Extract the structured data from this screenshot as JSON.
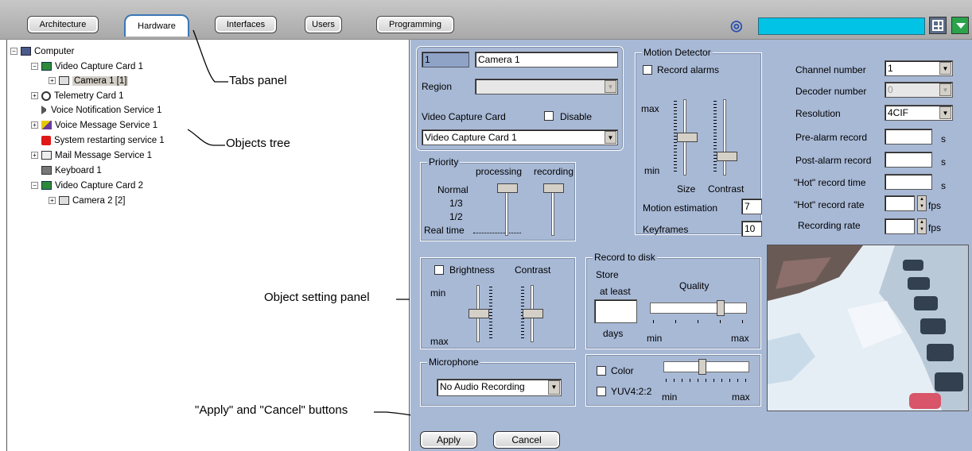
{
  "tabs": [
    "Architecture",
    "Hardware",
    "Interfaces",
    "Users",
    "Programming"
  ],
  "colors": {
    "accent": "#00c3e6",
    "panel": "#a8b9d6",
    "active_tab": "#3a77b5"
  },
  "tree": {
    "items": [
      {
        "label": "Computer",
        "icon": "computer-icon"
      },
      {
        "label": "Video Capture Card 1",
        "icon": "capture-card-icon"
      },
      {
        "label": "Camera 1 [1]",
        "icon": "camera-icon"
      },
      {
        "label": "Telemetry Card 1",
        "icon": "telemetry-icon"
      },
      {
        "label": "Voice Notification Service 1",
        "icon": "speaker-icon"
      },
      {
        "label": "Voice Message Service 1",
        "icon": "voice-message-icon"
      },
      {
        "label": "System restarting service 1",
        "icon": "restart-icon"
      },
      {
        "label": "Mail Message Service 1",
        "icon": "mail-icon"
      },
      {
        "label": "Keyboard 1",
        "icon": "keyboard-icon"
      },
      {
        "label": "Video Capture Card 2",
        "icon": "capture-card-icon"
      },
      {
        "label": "Camera 2 [2]",
        "icon": "camera-icon"
      }
    ]
  },
  "annotations": {
    "tabs_panel": "Tabs panel",
    "objects_tree": "Objects tree",
    "object_setting_panel": "Object setting panel",
    "apply_cancel": "\"Apply\" and \"Cancel\" buttons"
  },
  "camera": {
    "id": "1",
    "name": "Camera 1",
    "region_label": "Region",
    "region_value": "",
    "vcc_label": "Video Capture Card",
    "disable_label": "Disable",
    "disable_checked": false,
    "vcc_value": "Video Capture Card 1"
  },
  "priority": {
    "title": "Priority",
    "processing": "processing",
    "recording": "recording",
    "normal": "Normal",
    "one_third": "1/3",
    "half": "1/2",
    "realtime": "Real time",
    "processing_level": "Normal",
    "recording_level": "Normal"
  },
  "motion": {
    "title": "Motion Detector",
    "record_alarms": "Record alarms",
    "record_alarms_checked": false,
    "max": "max",
    "min": "min",
    "size": "Size",
    "contrast": "Contrast",
    "estimation_label": "Motion estimation",
    "estimation_value": "7",
    "keyframes_label": "Keyframes",
    "keyframes_value": "10"
  },
  "settings": {
    "channel_label": "Channel number",
    "channel_value": "1",
    "decoder_label": "Decoder number",
    "decoder_value": "0",
    "resolution_label": "Resolution",
    "resolution_value": "4CIF",
    "prealarm_label": "Pre-alarm record",
    "prealarm_unit": "s",
    "postalarm_label": "Post-alarm record",
    "postalarm_unit": "s",
    "hot_time_label": "\"Hot\" record time",
    "hot_time_unit": "s",
    "hot_rate_label": "\"Hot\" record rate",
    "hot_rate_unit": "fps",
    "rec_rate_label": "Recording rate",
    "rec_rate_unit": "fps"
  },
  "image_adjust": {
    "brightness": "Brightness",
    "contrast": "Contrast",
    "min": "min",
    "max": "max"
  },
  "record_disk": {
    "title": "Record to disk",
    "store": "Store",
    "at_least": "at least",
    "days": "days",
    "quality": "Quality",
    "min": "min",
    "max": "max",
    "quality_level": 0.75
  },
  "microphone": {
    "title": "Microphone",
    "value": "No Audio Recording"
  },
  "color": {
    "color_label": "Color",
    "yuv_label": "YUV4:2:2",
    "min": "min",
    "max": "max",
    "color_level": 0.45
  },
  "buttons": {
    "apply": "Apply",
    "cancel": "Cancel"
  }
}
